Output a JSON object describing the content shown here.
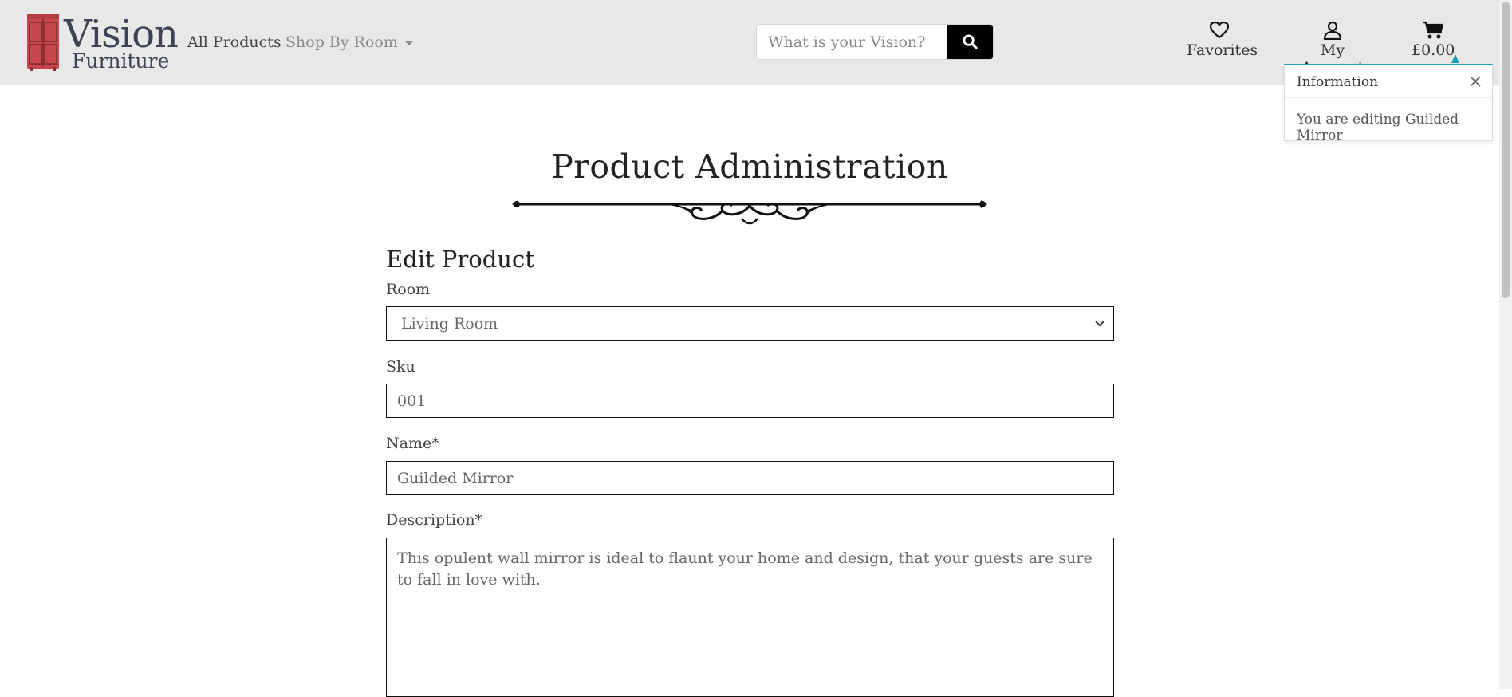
{
  "brand": {
    "name": "Vision",
    "tagline": "Furniture"
  },
  "nav": {
    "all_products": "All Products",
    "shop_by_room": "Shop By Room"
  },
  "search": {
    "placeholder": "What is your Vision?"
  },
  "actions": {
    "favorites": "Favorites",
    "my_account": "My Account",
    "cart_total": "£0.00"
  },
  "toast": {
    "title": "Information",
    "message": "You are editing Guilded Mirror"
  },
  "page": {
    "title": "Product Administration",
    "section_title": "Edit Product"
  },
  "form": {
    "room": {
      "label": "Room",
      "value": "Living Room"
    },
    "sku": {
      "label": "Sku",
      "value": "001"
    },
    "name": {
      "label": "Name*",
      "value": "Guilded Mirror"
    },
    "description": {
      "label": "Description*",
      "value": "This opulent wall mirror is ideal to flaunt your home and design, that your guests are sure to fall in love with."
    }
  },
  "colors": {
    "navbar_bg": "#e9e8e9",
    "logo_red": "#c8474c",
    "brand_text": "#3d4255",
    "toast_accent": "#17a2b8"
  }
}
